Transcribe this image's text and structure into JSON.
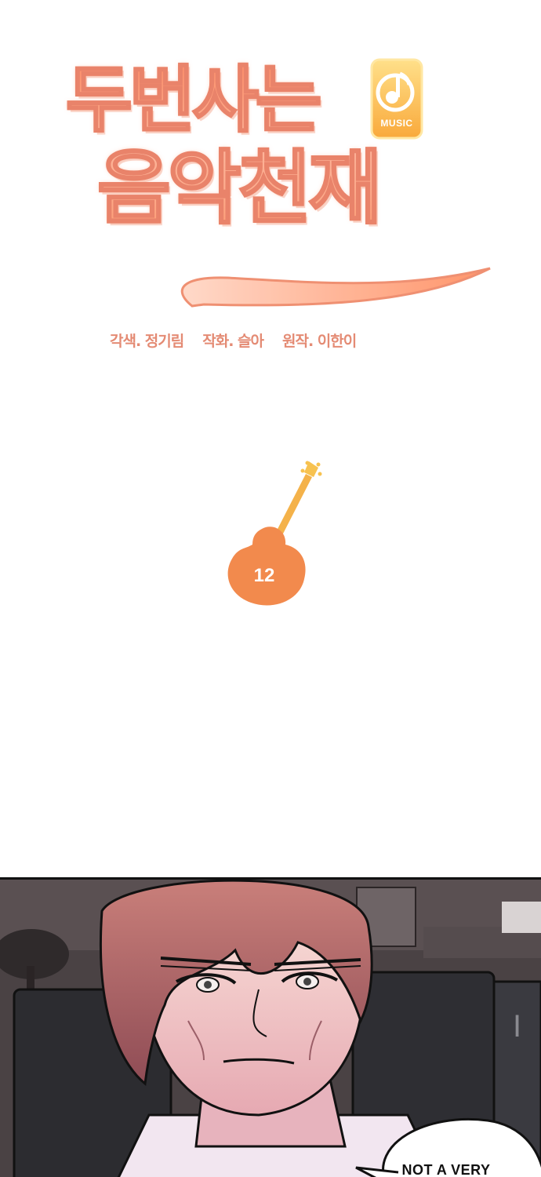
{
  "title": {
    "line1": "두번사는",
    "line2": "음악천재",
    "badge_label": "MUSIC",
    "colors": {
      "stroke": "#e9836a",
      "gradient_top": "#ff8a6a",
      "gradient_bottom": "#ffb48a",
      "badge": "#ffc84a"
    }
  },
  "credits": {
    "adaptation": "각색. 정기림",
    "art": "작화. 슬아",
    "original": "원작. 이한이"
  },
  "episode": {
    "number": "12",
    "icon": "guitar-icon",
    "color": "#f08a4b"
  },
  "panel": {
    "speech_bubble_text": "NOT A VERY"
  }
}
